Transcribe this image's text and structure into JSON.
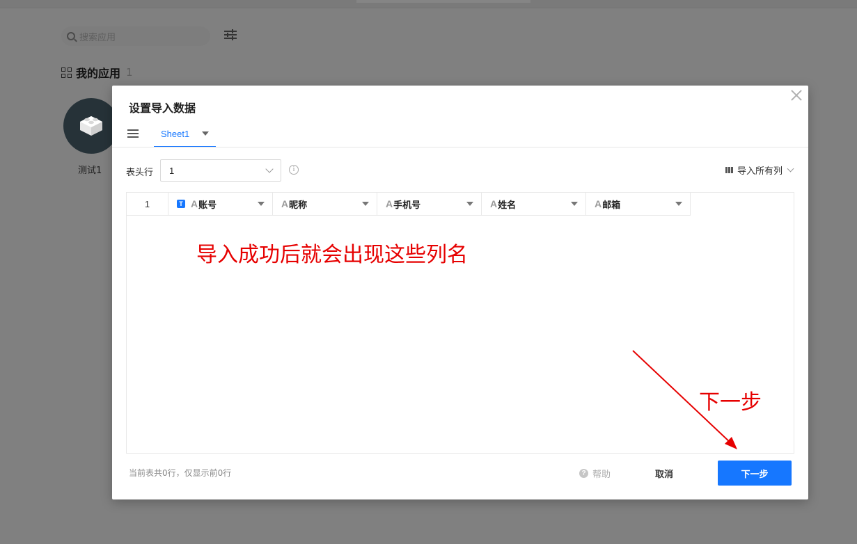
{
  "background": {
    "search_placeholder": "搜索应用",
    "section_title": "我的应用",
    "section_count": "1",
    "app_name": "测试1"
  },
  "modal": {
    "title": "设置导入数据",
    "sheet_tab": "Sheet1",
    "header_row_label": "表头行",
    "header_row_value": "1",
    "import_all_label": "导入所有列",
    "table": {
      "row_index": "1",
      "columns": [
        {
          "type_icon": "text-type-icon",
          "label": "账号",
          "primary": true
        },
        {
          "type_icon": "text-type-icon",
          "label": "昵称"
        },
        {
          "type_icon": "text-type-icon",
          "label": "手机号"
        },
        {
          "type_icon": "text-type-icon",
          "label": "姓名"
        },
        {
          "type_icon": "text-type-icon",
          "label": "邮箱"
        }
      ],
      "primary_badge": "T",
      "type_glyph": "A"
    },
    "footer_note": "当前表共0行，仅显示前0行",
    "help_label": "帮助",
    "cancel_label": "取消",
    "next_label": "下一步"
  },
  "annotations": {
    "main_text": "导入成功后就会出现这些列名",
    "next_text": "下一步",
    "color": "#e60000"
  },
  "colors": {
    "accent": "#1677ff",
    "overlay": "#808080"
  }
}
